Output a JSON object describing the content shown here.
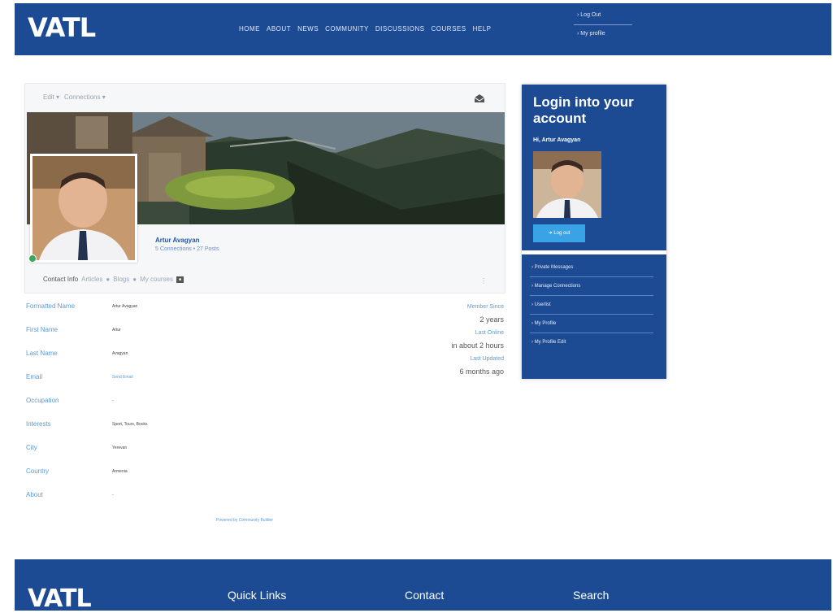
{
  "header": {
    "logo": "VATL",
    "nav": [
      "HOME",
      "ABOUT",
      "NEWS",
      "COMMUNITY",
      "DISCUSSIONS",
      "COURSES",
      "HELP"
    ],
    "user_links": [
      "Log Out",
      "My profile"
    ]
  },
  "profile": {
    "toolbar": [
      "Edit ▾",
      "Connections ▾"
    ],
    "name": "Artur Avagyan",
    "meta": "5 Connections  • 27 Posts",
    "tabs": [
      "Contact Info",
      "Articles",
      "Blogs",
      "My courses"
    ],
    "fields": [
      {
        "label": "Formatted Name",
        "value": "Artur Avagyan"
      },
      {
        "label": "First Name",
        "value": "Artur"
      },
      {
        "label": "Last Name",
        "value": "Avagyan"
      },
      {
        "label": "Email",
        "value": "Send Email"
      },
      {
        "label": "Occupation",
        "value": "-"
      },
      {
        "label": "Interests",
        "value": "Sport, Tours, Books"
      },
      {
        "label": "City",
        "value": "Yerevan"
      },
      {
        "label": "Country",
        "value": "Armenia"
      },
      {
        "label": "About",
        "value": "-"
      }
    ],
    "meta_stats": [
      {
        "label": "Member Since",
        "value": "2 years"
      },
      {
        "label": "Last Online",
        "value": "in about 2 hours"
      },
      {
        "label": "Last Updated",
        "value": "6 months ago"
      }
    ],
    "powered": "Powered by Community Builder"
  },
  "login_panel": {
    "title": "Login into your account",
    "greeting": "Hi, Artur Avagyan",
    "logout_button": "Log out",
    "links": [
      "Private Messages",
      "Manage Connections",
      "Userlist",
      "My Profile",
      "My Profile Edit"
    ]
  },
  "footer": {
    "logo": "VATL",
    "headings": [
      "Quick Links",
      "Contact",
      "Search"
    ]
  },
  "colors": {
    "primary": "#1c4b94",
    "accent": "#39a3e6",
    "label": "#5a9bd6"
  }
}
